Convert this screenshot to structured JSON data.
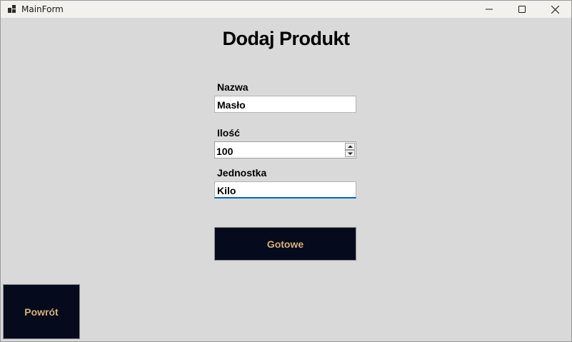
{
  "window": {
    "title": "MainForm"
  },
  "form": {
    "heading": "Dodaj Produkt",
    "fields": {
      "nazwa": {
        "label": "Nazwa",
        "value": "Masło"
      },
      "ilosc": {
        "label": "Ilość",
        "value": "100"
      },
      "jednostka": {
        "label": "Jednostka",
        "value": "Kilo"
      }
    },
    "submit_label": "Gotowe",
    "back_label": "Powrót"
  },
  "colors": {
    "button_bg": "#050a1c",
    "button_text": "#d6b079",
    "form_bg": "#d9d9d9",
    "focus_accent": "#0067c0"
  },
  "icons": [
    "app-icon",
    "minimize-icon",
    "maximize-icon",
    "close-icon",
    "spin-up-icon",
    "spin-down-icon"
  ]
}
